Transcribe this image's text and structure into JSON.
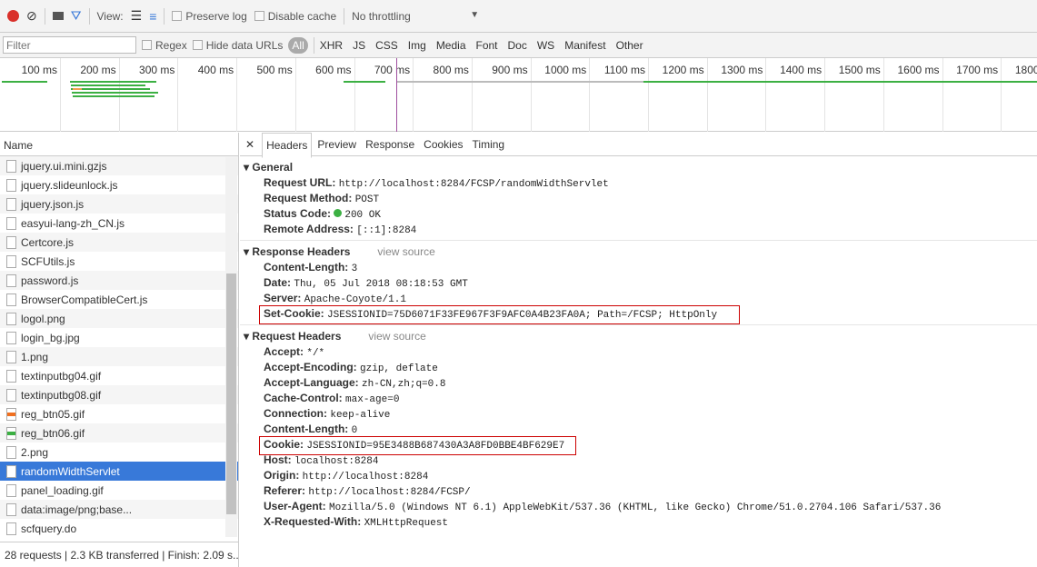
{
  "toolbar": {
    "view_label": "View:",
    "preserve_log": "Preserve log",
    "disable_cache": "Disable cache",
    "throttling": "No throttling"
  },
  "filterbar": {
    "placeholder": "Filter",
    "regex": "Regex",
    "hide_data_urls": "Hide data URLs",
    "all": "All",
    "types": [
      "XHR",
      "JS",
      "CSS",
      "Img",
      "Media",
      "Font",
      "Doc",
      "WS",
      "Manifest",
      "Other"
    ]
  },
  "timeline": {
    "ticks": [
      "100 ms",
      "200 ms",
      "300 ms",
      "400 ms",
      "500 ms",
      "600 ms",
      "700 ms",
      "800 ms",
      "900 ms",
      "1000 ms",
      "1100 ms",
      "1200 ms",
      "1300 ms",
      "1400 ms",
      "1500 ms",
      "1600 ms",
      "1700 ms",
      "1800 ms"
    ]
  },
  "requests": {
    "header": "Name",
    "items": [
      "jquery.ui.mini.gzjs",
      "jquery.slideunlock.js",
      "jquery.json.js",
      "easyui-lang-zh_CN.js",
      "Certcore.js",
      "SCFUtils.js",
      "password.js",
      "BrowserCompatibleCert.js",
      "logol.png",
      "login_bg.jpg",
      "1.png",
      "textinputbg04.gif",
      "textinputbg08.gif",
      "reg_btn05.gif",
      "reg_btn06.gif",
      "2.png",
      "randomWidthServlet",
      "panel_loading.gif",
      "data:image/png;base...",
      "scfquery.do"
    ],
    "selected": "randomWidthServlet",
    "status": "28 requests | 2.3 KB transferred | Finish: 2.09 s..."
  },
  "details": {
    "tabs": [
      "Headers",
      "Preview",
      "Response",
      "Cookies",
      "Timing"
    ],
    "general": {
      "title": "General",
      "rows": [
        [
          "Request URL:",
          "http://localhost:8284/FCSP/randomWidthServlet"
        ],
        [
          "Request Method:",
          "POST"
        ],
        [
          "Status Code:",
          "200 OK"
        ],
        [
          "Remote Address:",
          "[::1]:8284"
        ]
      ]
    },
    "response": {
      "title": "Response Headers",
      "view_source": "view source",
      "rows": [
        [
          "Content-Length:",
          "3"
        ],
        [
          "Date:",
          "Thu, 05 Jul 2018 08:18:53 GMT"
        ],
        [
          "Server:",
          "Apache-Coyote/1.1"
        ],
        [
          "Set-Cookie:",
          "JSESSIONID=75D6071F33FE967F3F9AFC0A4B23FA0A; Path=/FCSP; HttpOnly"
        ]
      ]
    },
    "request": {
      "title": "Request Headers",
      "view_source": "view source",
      "rows": [
        [
          "Accept:",
          "*/*"
        ],
        [
          "Accept-Encoding:",
          "gzip, deflate"
        ],
        [
          "Accept-Language:",
          "zh-CN,zh;q=0.8"
        ],
        [
          "Cache-Control:",
          "max-age=0"
        ],
        [
          "Connection:",
          "keep-alive"
        ],
        [
          "Content-Length:",
          "0"
        ],
        [
          "Cookie:",
          "JSESSIONID=95E3488B687430A3A8FD0BBE4BF629E7"
        ],
        [
          "Host:",
          "localhost:8284"
        ],
        [
          "Origin:",
          "http://localhost:8284"
        ],
        [
          "Referer:",
          "http://localhost:8284/FCSP/"
        ],
        [
          "User-Agent:",
          "Mozilla/5.0 (Windows NT 6.1) AppleWebKit/537.36 (KHTML, like Gecko) Chrome/51.0.2704.106 Safari/537.36"
        ],
        [
          "X-Requested-With:",
          "XMLHttpRequest"
        ]
      ]
    }
  }
}
